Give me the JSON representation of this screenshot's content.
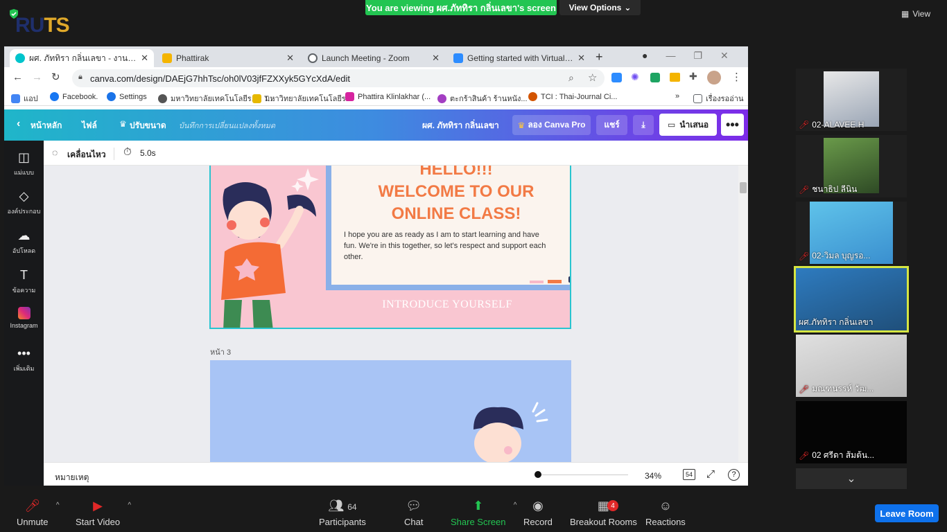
{
  "zoom": {
    "banner": "You are viewing ผศ.ภัททิรา กลิ่นเลขา's screen",
    "view_options": "View Options",
    "view_label": "View",
    "logo_main": "RU",
    "logo_accent": "TS",
    "leave": "Leave Room",
    "toolbar": {
      "unmute": "Unmute",
      "start_video": "Start Video",
      "participants": "Participants",
      "participants_count": "64",
      "chat": "Chat",
      "share_screen": "Share Screen",
      "record": "Record",
      "breakout_rooms": "Breakout Rooms",
      "breakout_badge": "4",
      "reactions": "Reactions"
    },
    "participants": [
      {
        "name": "02-ALAVEE.H",
        "muted": true
      },
      {
        "name": "ชนาธิป ลีนิน",
        "muted": true
      },
      {
        "name": "02-วิมล บุญรอ...",
        "muted": true
      },
      {
        "name": "ผศ.ภัททิรา กลิ่นเลขา",
        "muted": false
      },
      {
        "name": "มณฑนรรห์ วัฒ...",
        "muted": true
      },
      {
        "name": "02 ศรีดา ส้มต้น...",
        "muted": true
      }
    ]
  },
  "browser": {
    "tabs": [
      {
        "label": "ผศ. ภัททิรา กลิ่นเลขา - งานนำเสนอ (",
        "color": "#00c4cc"
      },
      {
        "label": "Phattirak",
        "color": "#f4b400"
      },
      {
        "label": "Launch Meeting - Zoom",
        "color": "#5f6368"
      },
      {
        "label": "Getting started with Virtual Back",
        "color": "#2d8cff"
      }
    ],
    "url": "canva.com/design/DAEjG7hhTsc/oh0lV03jfFZXXyk5GYcXdA/edit",
    "bookmarks": [
      {
        "label": "แอป",
        "color": "#4285f4"
      },
      {
        "label": "Facebook.",
        "color": "#1877f2"
      },
      {
        "label": "Settings",
        "color": "#1a73e8"
      },
      {
        "label": "มหาวิทยาลัยเทคโนโลยีร... : T...",
        "color": "#555555"
      },
      {
        "label": "มหาวิทยาลัยเทคโนโลยีร...",
        "color": "#e6b800"
      },
      {
        "label": "Phattira Klinlakhar (...",
        "color": "#d6249f"
      },
      {
        "label": "ตะกร้าสินค้า ร้านหนัง...",
        "color": "#a33ec2"
      },
      {
        "label": "TCI : Thai-Journal Ci...",
        "color": "#d35400"
      },
      {
        "label": "เรื่องรออ่าน",
        "color": "#5f6368"
      }
    ]
  },
  "canva": {
    "home": "หน้าหลัก",
    "file": "ไฟล์",
    "resize": "ปรับขนาด",
    "saved_status": "บันทึกการเปลี่ยนแปลงทั้งหมด",
    "owner": "ผศ. ภัททิรา กลิ่นเลขา",
    "try_pro": "ลอง Canva Pro",
    "share": "แชร์",
    "present": "นำเสนอ",
    "sidebar": [
      {
        "label": "แม่แบบ",
        "icon": "template-icon"
      },
      {
        "label": "องค์ประกอบ",
        "icon": "elements-icon"
      },
      {
        "label": "อัปโหลด",
        "icon": "upload-icon"
      },
      {
        "label": "ข้อความ",
        "icon": "text-icon"
      },
      {
        "label": "Instagram",
        "icon": "instagram-icon"
      },
      {
        "label": "เพิ่มเติม",
        "icon": "more-icon"
      }
    ],
    "animate": "เคลื่อนไหว",
    "duration": "5.0s",
    "slide_hello": "HELLO!!!",
    "slide_welcome_1": "WELCOME TO OUR",
    "slide_welcome_2": "ONLINE CLASS!",
    "slide_body": "I hope you are as ready as I am to start learning and have fun.  We're in this together, so let's respect and support each other.",
    "slide_intro": "INTRODUCE YOURSELF",
    "page3": "หน้า 3",
    "notes": "หมายเหตุ",
    "zoom_pct": "34%",
    "page_count": "54",
    "help": "?"
  }
}
